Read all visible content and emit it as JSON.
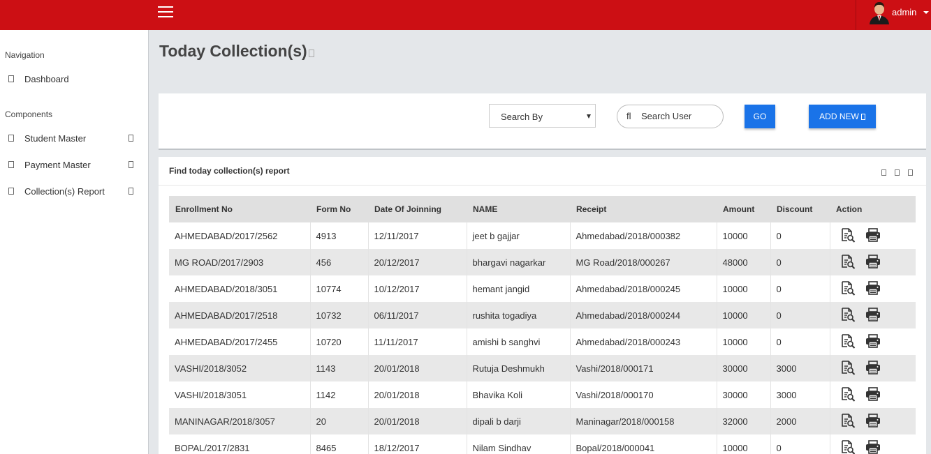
{
  "header": {
    "user_name": "admin",
    "menu_icon": "hamburger-icon"
  },
  "sidebar": {
    "navigation_heading": "Navigation",
    "components_heading": "Components",
    "items": [
      {
        "label": "Dashboard"
      },
      {
        "label": "Student Master"
      },
      {
        "label": "Payment Master"
      },
      {
        "label": "Collection(s) Report"
      }
    ]
  },
  "page": {
    "title": "Today Collection(s)"
  },
  "search": {
    "select_value": "Search By",
    "input_icon": "fl",
    "placeholder": "Search User",
    "go_label": "GO",
    "add_label": "ADD NEW"
  },
  "report": {
    "title": "Find today collection(s) report",
    "columns": [
      "Enrollment No",
      "Form No",
      "Date Of Joinning",
      "NAME",
      "Receipt",
      "Amount",
      "Discount",
      "Action"
    ],
    "rows": [
      [
        "AHMEDABAD/2017/2562",
        "4913",
        "12/11/2017",
        "jeet b gajjar",
        "Ahmedabad/2018/000382",
        "10000",
        "0"
      ],
      [
        "MG ROAD/2017/2903",
        "456",
        "20/12/2017",
        "bhargavi nagarkar",
        "MG Road/2018/000267",
        "48000",
        "0"
      ],
      [
        "AHMEDABAD/2018/3051",
        "10774",
        "10/12/2017",
        "hemant jangid",
        "Ahmedabad/2018/000245",
        "10000",
        "0"
      ],
      [
        "AHMEDABAD/2017/2518",
        "10732",
        "06/11/2017",
        "rushita togadiya",
        "Ahmedabad/2018/000244",
        "10000",
        "0"
      ],
      [
        "AHMEDABAD/2017/2455",
        "10720",
        "11/11/2017",
        "amishi b sanghvi",
        "Ahmedabad/2018/000243",
        "10000",
        "0"
      ],
      [
        "VASHI/2018/3052",
        "1143",
        "20/01/2018",
        "Rutuja Deshmukh",
        "Vashi/2018/000171",
        "30000",
        "3000"
      ],
      [
        "VASHI/2018/3051",
        "1142",
        "20/01/2018",
        "Bhavika Koli",
        "Vashi/2018/000170",
        "30000",
        "3000"
      ],
      [
        "MANINAGAR/2018/3057",
        "20",
        "20/01/2018",
        "dipali b darji",
        "Maninagar/2018/000158",
        "32000",
        "2000"
      ],
      [
        "BOPAL/2017/2831",
        "8465",
        "18/12/2017",
        "Nilam Sindhav",
        "Bopal/2018/000041",
        "10000",
        "0"
      ]
    ]
  },
  "colors": {
    "topbar": "#cc0f14",
    "button": "#1a73e8",
    "row_alt": "#e8e8e8",
    "header_row": "#e0e0e0"
  },
  "icons": {
    "view": "view-receipt-icon",
    "print": "print-icon"
  }
}
